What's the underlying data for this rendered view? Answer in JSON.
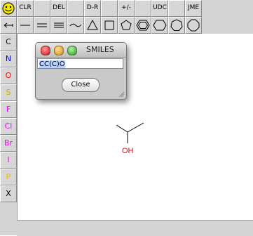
{
  "toolbar": {
    "top": [
      {
        "id": "smiley",
        "label": ""
      },
      {
        "id": "clr",
        "label": "CLR"
      },
      {
        "id": "blank1",
        "label": ""
      },
      {
        "id": "del",
        "label": "DEL"
      },
      {
        "id": "blank2",
        "label": ""
      },
      {
        "id": "dr",
        "label": "D-R"
      },
      {
        "id": "blank3",
        "label": ""
      },
      {
        "id": "pm",
        "label": "+/-"
      },
      {
        "id": "blank4",
        "label": ""
      },
      {
        "id": "udc",
        "label": "UDC"
      },
      {
        "id": "blank5",
        "label": ""
      },
      {
        "id": "jme",
        "label": "JME"
      }
    ],
    "shapes": [
      "arrow-icon",
      "single-bond-icon",
      "double-bond-icon",
      "triple-bond-icon",
      "chain-icon",
      "triangle-icon",
      "square-icon",
      "pentagon-icon",
      "benzene-icon",
      "hexagon-icon",
      "heptagon-icon",
      "octagon-icon"
    ]
  },
  "atoms": [
    {
      "label": "C",
      "color": "#000000"
    },
    {
      "label": "N",
      "color": "#0000ff"
    },
    {
      "label": "O",
      "color": "#ff0000"
    },
    {
      "label": "S",
      "color": "#c8b400"
    },
    {
      "label": "F",
      "color": "#ff00ff"
    },
    {
      "label": "Cl",
      "color": "#ff00ff"
    },
    {
      "label": "Br",
      "color": "#ff00ff"
    },
    {
      "label": "I",
      "color": "#ff00ff"
    },
    {
      "label": "P",
      "color": "#ffb400"
    },
    {
      "label": "X",
      "color": "#000000"
    }
  ],
  "dialog": {
    "title": "SMILES",
    "smiles": "CC(C)O",
    "close_label": "Close"
  },
  "molecule": {
    "hetero_label": "OH",
    "hetero_color": "#ff0000"
  }
}
